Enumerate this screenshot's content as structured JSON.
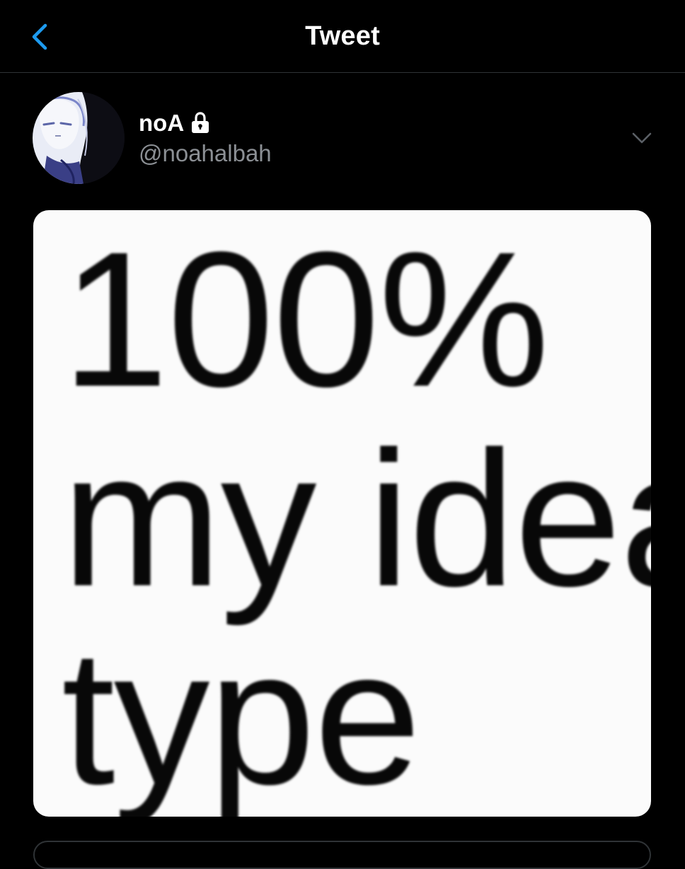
{
  "header": {
    "title": "Tweet",
    "back_icon": "chevron-left-icon"
  },
  "author": {
    "display_name": "noA",
    "handle": "@noahalbah",
    "protected_icon": "lock-icon",
    "avatar_icon": "avatar"
  },
  "tweet": {
    "media_text_line1": "100%",
    "media_text_line2": "my ideal",
    "media_text_line3": "type",
    "menu_icon": "chevron-down-icon"
  },
  "colors": {
    "background": "#000000",
    "accent": "#1d9bf0",
    "secondary_text": "#8b8f94",
    "divider": "#2f3336"
  }
}
